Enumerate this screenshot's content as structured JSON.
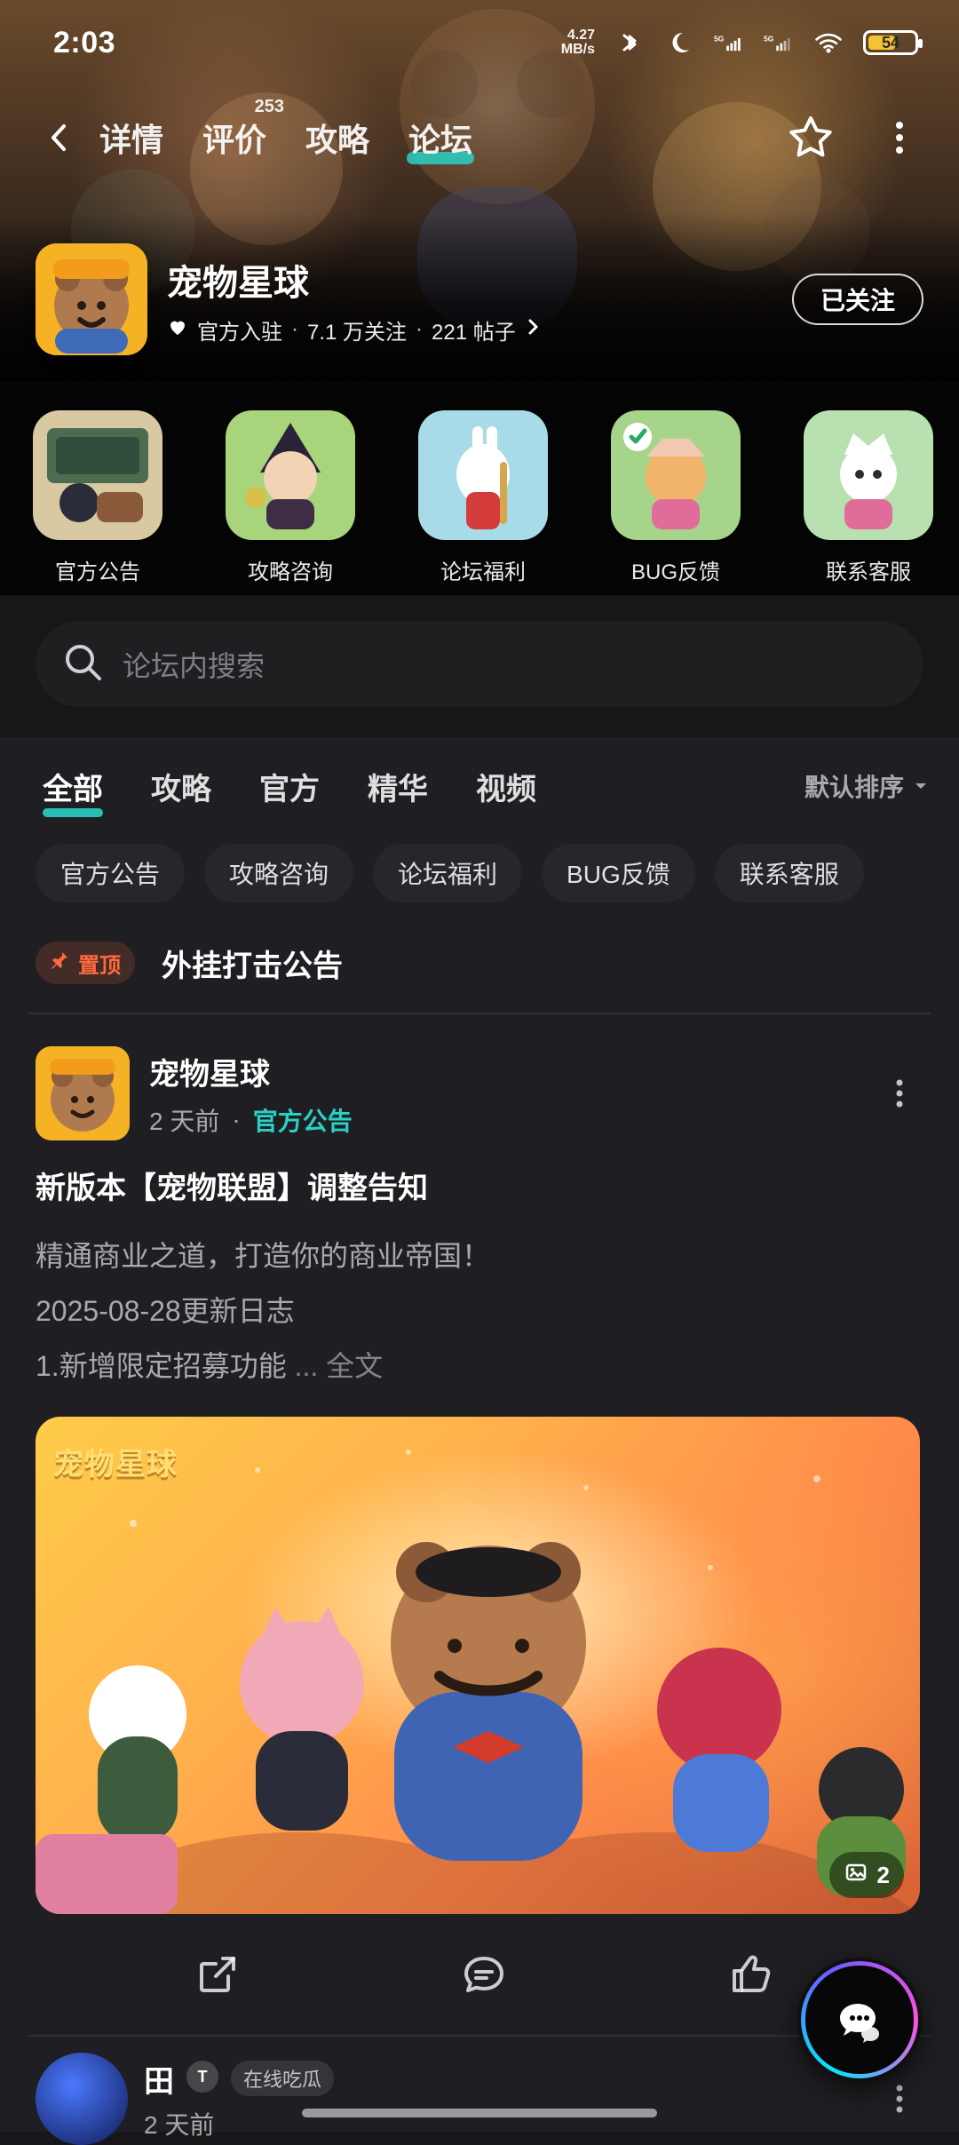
{
  "colors": {
    "accent": "#2ad0c5",
    "pin": "#ff6a3d",
    "background": "#17171a"
  },
  "status": {
    "time": "2:03",
    "net_speed_value": "4.27",
    "net_speed_unit": "MB/s",
    "battery": "54"
  },
  "nav": {
    "tabs": [
      {
        "label": "详情",
        "badge": ""
      },
      {
        "label": "评价",
        "badge": "253"
      },
      {
        "label": "攻略",
        "badge": ""
      },
      {
        "label": "论坛",
        "badge": ""
      }
    ]
  },
  "game": {
    "name": "宠物星球",
    "official": "官方入驻",
    "followers": "7.1 万关注",
    "posts": "221 帖子",
    "follow_button": "已关注"
  },
  "categories": [
    {
      "label": "官方公告",
      "icon": "announcement-art"
    },
    {
      "label": "攻略咨询",
      "icon": "guide-art"
    },
    {
      "label": "论坛福利",
      "icon": "benefits-art"
    },
    {
      "label": "BUG反馈",
      "icon": "bug-feedback-art"
    },
    {
      "label": "联系客服",
      "icon": "customer-service-art"
    }
  ],
  "search": {
    "placeholder": "论坛内搜索"
  },
  "filters": {
    "tabs": [
      "全部",
      "攻略",
      "官方",
      "精华",
      "视频"
    ],
    "sort": "默认排序",
    "chips": [
      "官方公告",
      "攻略咨询",
      "论坛福利",
      "BUG反馈",
      "联系客服"
    ]
  },
  "pinned": {
    "badge": "置顶",
    "title": "外挂打击公告"
  },
  "post": {
    "author": "宠物星球",
    "time": "2 天前",
    "category": "官方公告",
    "title": "新版本【宠物联盟】调整告知",
    "lines": [
      "精通商业之道，打造你的商业帝国！",
      "2025-08-28更新日志",
      "1.新增限定招募功能"
    ],
    "readmore": "... 全文",
    "image_logo": "宠物星球",
    "image_count": "2"
  },
  "next_post": {
    "author": "田",
    "badge": "在线吃瓜",
    "time": "2 天前"
  }
}
